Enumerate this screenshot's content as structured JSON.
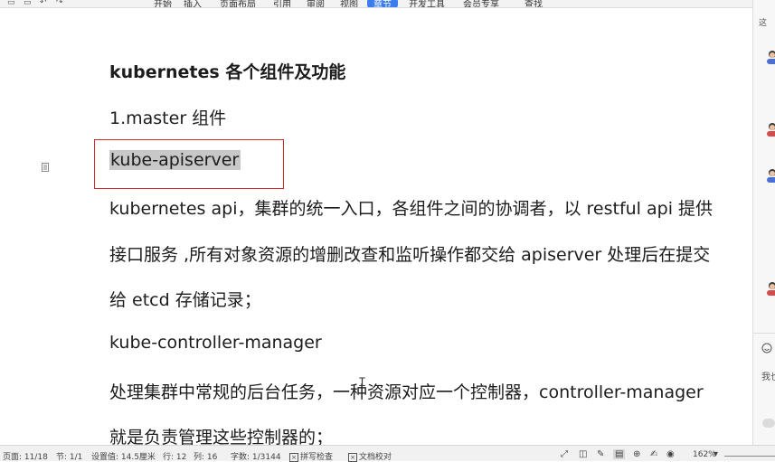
{
  "toolbar": {
    "menus": [
      "开始",
      "插入",
      "页面布局",
      "引用",
      "审阅",
      "视图",
      "章节",
      "开发工具",
      "会员专享",
      "查找"
    ],
    "active_menu": "章节"
  },
  "document": {
    "title": "kubernetes 各个组件及功能",
    "section": "1.master 组件",
    "component1": "kube-apiserver",
    "desc1_line1": "kubernetes api，集群的统一入口，各组件之间的协调者，以 restful api 提供",
    "desc1_line2": "接口服务 ,所有对象资源的增删改查和监听操作都交给 apiserver 处理后在提交",
    "desc1_line3": "给 etcd 存储记录；",
    "component2": "kube-controller-manager",
    "desc2_line1": "处理集群中常规的后台任务，一种资源对应一个控制器，controller-manager",
    "desc2_line2": "就是负责管理这些控制器的；"
  },
  "sidepanel": {
    "tab_label": "这",
    "hint": "我也"
  },
  "statusbar": {
    "page": "页面: 11/18",
    "section": "节: 1/1",
    "setting": "设置值: 14.5厘米",
    "row": "行: 12",
    "col": "列: 16",
    "wordcount": "字数: 1/3144",
    "spellcheck": "拼写检查",
    "proofread": "文档校对",
    "zoom": "162%"
  },
  "colors": {
    "highlight_box": "#d42a2a",
    "selection": "#c8c8c8",
    "active_menu": "#3b7ded"
  }
}
